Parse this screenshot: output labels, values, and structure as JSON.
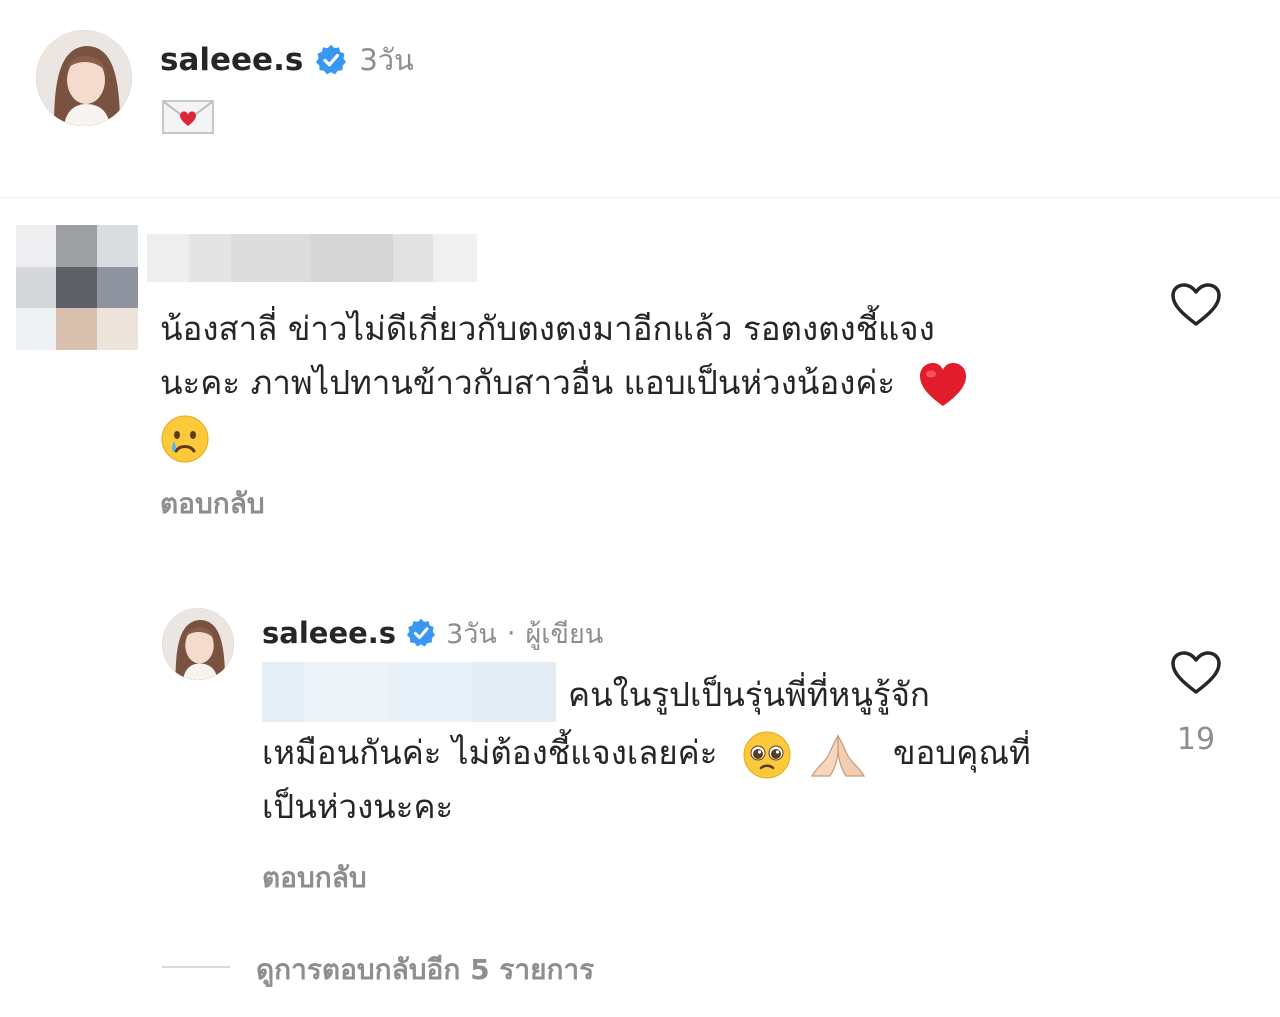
{
  "caption": {
    "username": "saleee.s",
    "time": "3วัน",
    "text": ""
  },
  "comment": {
    "lines": [
      "น้องสาลี่ ข่าวไม่ดีเกี่ยวกับตงตงมาอีกแล้ว รอตงตงชี้แจง",
      "นะคะ ภาพไปทานข้าวกับสาวอื่น แอบเป็นห่วงน้องค่ะ"
    ],
    "emoji_heart": "❤️",
    "emoji_cry": "😢",
    "reply_label": "ตอบกลับ"
  },
  "reply": {
    "username": "saleee.s",
    "time": "3วัน",
    "author_label": "ผู้เขียน",
    "separator": "·",
    "line1": "คนในรูปเป็นรุ่นพี่ที่หนูรู้จัก",
    "line2_a": "เหมือนกันค่ะ ไม่ต้องชี้แจงเลยค่ะ",
    "line2_b": "ขอบคุณที่",
    "line3": "เป็นห่วงนะคะ",
    "emoji_pleading": "🥺",
    "emoji_pray": "🙏🏻",
    "reply_label": "ตอบกลับ",
    "like_count": "19"
  },
  "view_more": {
    "label": "ดูการตอบกลับอีก 5 รายการ"
  },
  "colors": {
    "text": "#262626",
    "secondary": "#8e8e8e",
    "verified": "#3897f0",
    "divider": "#efefef"
  }
}
